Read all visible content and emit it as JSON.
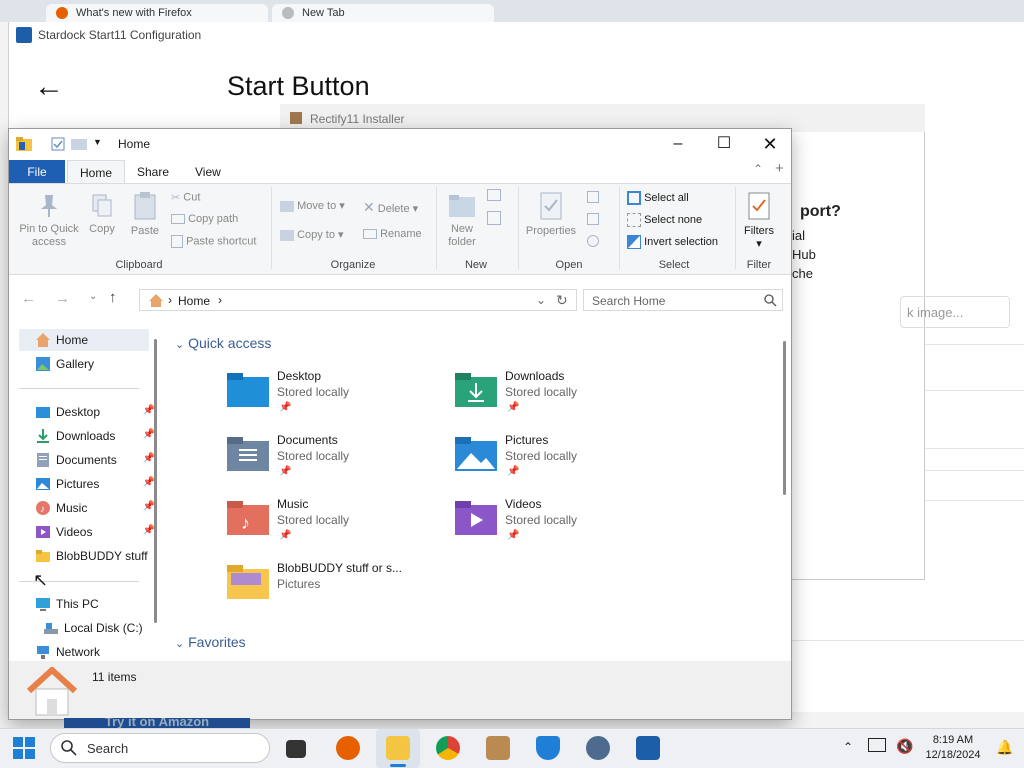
{
  "browser": {
    "tab1": "What's new with Firefox",
    "tab2": "New Tab"
  },
  "start11": {
    "title": "Stardock Start11 Configuration",
    "heading": "Start Button"
  },
  "rectify": {
    "title": "Rectify11 Installer",
    "heading": "port?",
    "line1": "ial",
    "line2": "Hub",
    "line3": "che",
    "input_placeholder": "k image..."
  },
  "explorer": {
    "title": "Home",
    "ribbon_tabs": [
      "File",
      "Home",
      "Share",
      "View"
    ],
    "clipboard": {
      "pin": "Pin to Quick access",
      "copy": "Copy",
      "paste": "Paste",
      "cut": "Cut",
      "copy_path": "Copy path",
      "paste_shortcut": "Paste shortcut",
      "group": "Clipboard"
    },
    "organize": {
      "move_to": "Move to",
      "copy_to": "Copy to",
      "delete": "Delete",
      "rename": "Rename",
      "group": "Organize"
    },
    "new": {
      "new_folder": "New folder",
      "group": "New"
    },
    "open": {
      "properties": "Properties",
      "group": "Open"
    },
    "select": {
      "select_all": "Select all",
      "select_none": "Select none",
      "invert": "Invert selection",
      "group": "Select"
    },
    "filter": {
      "filters": "Filters",
      "group": "Filter"
    },
    "address": {
      "crumb": "Home"
    },
    "search": {
      "placeholder": "Search Home"
    },
    "nav": {
      "home": "Home",
      "gallery": "Gallery",
      "pinned": [
        "Desktop",
        "Downloads",
        "Documents",
        "Pictures",
        "Music",
        "Videos"
      ],
      "blob": "BlobBUDDY stuff",
      "this_pc": "This PC",
      "local_disk": "Local Disk (C:)",
      "network": "Network"
    },
    "quick_access": {
      "header": "Quick access",
      "items": [
        {
          "name": "Desktop",
          "sub": "Stored locally"
        },
        {
          "name": "Downloads",
          "sub": "Stored locally"
        },
        {
          "name": "Documents",
          "sub": "Stored locally"
        },
        {
          "name": "Pictures",
          "sub": "Stored locally"
        },
        {
          "name": "Music",
          "sub": "Stored locally"
        },
        {
          "name": "Videos",
          "sub": "Stored locally"
        },
        {
          "name": "BlobBUDDY stuff or s...",
          "sub": "Pictures"
        }
      ]
    },
    "favorites_header": "Favorites",
    "status": "11 items"
  },
  "amazon": "Try it on Amazon",
  "taskbar": {
    "search": "Search",
    "time": "8:19 AM",
    "date": "12/18/2024"
  },
  "colors": {
    "file_tab": "#1f5fb3",
    "accent": "#3c5d94"
  }
}
